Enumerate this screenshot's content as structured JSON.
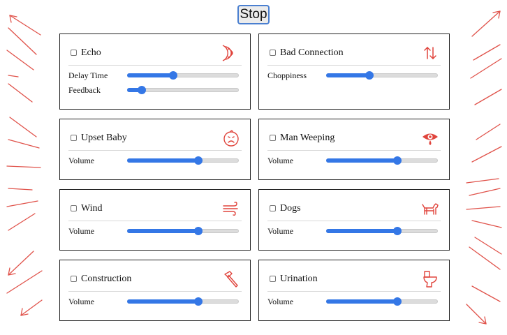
{
  "header": {
    "stop_label": "Stop"
  },
  "accent_color": "#3477e6",
  "icon_color": "#e0443c",
  "cards": [
    {
      "title": "Echo",
      "checked": false,
      "icon": "echo-waves-icon",
      "controls": [
        {
          "label": "Delay Time",
          "value": 0.41
        },
        {
          "label": "Feedback",
          "value": 0.13
        }
      ]
    },
    {
      "title": "Bad Connection",
      "checked": false,
      "icon": "up-down-arrows-icon",
      "controls": [
        {
          "label": "Choppiness",
          "value": 0.39
        }
      ]
    },
    {
      "title": "Upset Baby",
      "checked": false,
      "icon": "upset-face-icon",
      "controls": [
        {
          "label": "Volume",
          "value": 0.64
        }
      ]
    },
    {
      "title": "Man Weeping",
      "checked": false,
      "icon": "crying-eye-icon",
      "controls": [
        {
          "label": "Volume",
          "value": 0.64
        }
      ]
    },
    {
      "title": "Wind",
      "checked": false,
      "icon": "wind-icon",
      "controls": [
        {
          "label": "Volume",
          "value": 0.64
        }
      ]
    },
    {
      "title": "Dogs",
      "checked": false,
      "icon": "dog-icon",
      "controls": [
        {
          "label": "Volume",
          "value": 0.64
        }
      ]
    },
    {
      "title": "Construction",
      "checked": false,
      "icon": "hammer-icon",
      "controls": [
        {
          "label": "Volume",
          "value": 0.64
        }
      ]
    },
    {
      "title": "Urination",
      "checked": false,
      "icon": "toilet-icon",
      "controls": [
        {
          "label": "Volume",
          "value": 0.64
        }
      ]
    }
  ]
}
